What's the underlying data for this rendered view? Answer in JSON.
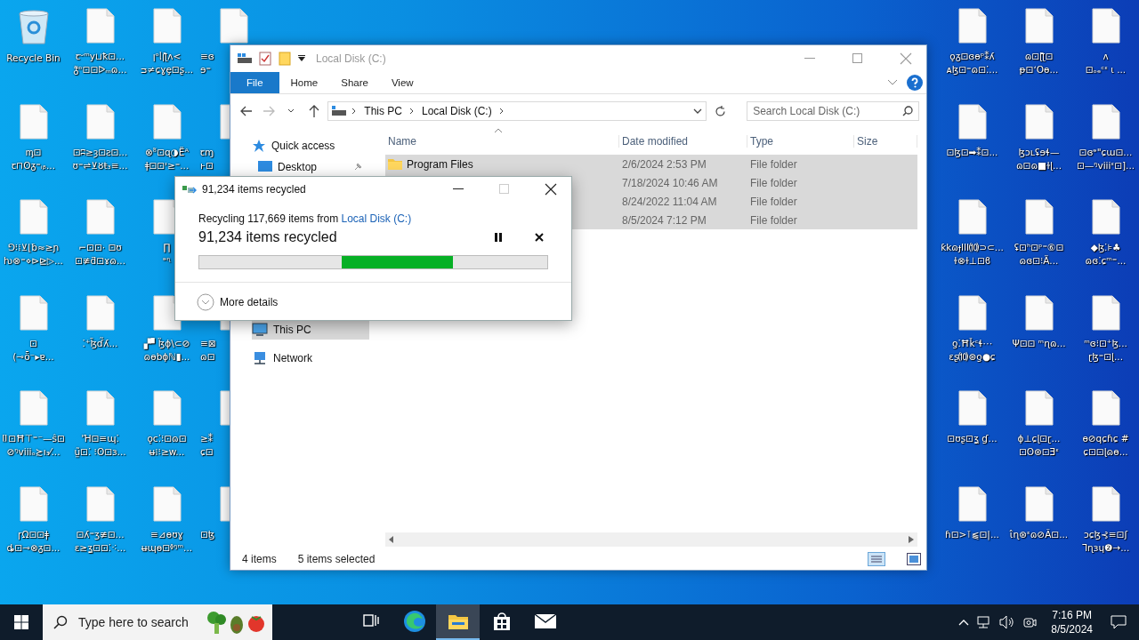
{
  "desktop": {
    "left_columns": [
      [
        {
          "kind": "recycle-bin",
          "label_lines": [
            "Recycle Bin"
          ]
        },
        {
          "kind": "file",
          "label_lines": [
            "ᶆ⊡",
            "ꞇ⊓ʘᵹ⁼ᵢᵦ..."
          ]
        },
        {
          "kind": "file",
          "label_lines": [
            "⅁⁝⁞⊻⌊ƀ≈≥ɲ",
            "ƕ⊗⁼⋄⊳⊵▷..."
          ]
        },
        {
          "kind": "file",
          "label_lines": [
            "⊡",
            "(⊸ȫ⁻▸ɐ..."
          ]
        },
        {
          "kind": "file",
          "label_lines": [
            "⌷⊡Ħ⊤⁼⁻—ŝ⊡",
            "⊘ᵑviiiₒ≿ı₃⁄..."
          ]
        },
        {
          "kind": "file",
          "label_lines": [
            "ɼΩ⊡⊡ǂ",
            "ȡ⊡⊸⊗ᵹ⊡..."
          ]
        }
      ],
      [
        {
          "kind": "file",
          "label_lines": [
            "ꞇᵕᵐy⊔ꝁ⊡...",
            "ᵹ̃ᶛ⊡⊡ᐅₘɷ..."
          ]
        },
        {
          "kind": "file",
          "label_lines": [
            "⊡ʭ≥ȝ⊡ƨ⊡...",
            "ʊ⁼⇌⊻ȣŧ₃≡..."
          ]
        },
        {
          "kind": "file",
          "label_lines": [
            "⌐⊡⊡· ⊡ʊ",
            "⊡≢ƌ⊡ɤɷ..."
          ]
        },
        {
          "kind": "file",
          "label_lines": [
            "⁚⁺ɮ̄ɗ̃ʎ..."
          ]
        },
        {
          "kind": "file",
          "label_lines": [
            "ˈꞪ⊡≡ɰ⁚",
            "ṳ̃⊡⁚ ⁝ʘ⊡ɜ..."
          ]
        },
        {
          "kind": "file",
          "label_lines": [
            "⊡ʎ⁼ʒ≢⊡...",
            "ɛ≥ʓ⊡⊡⁚⁖..."
          ]
        }
      ],
      [
        {
          "kind": "file",
          "label_lines": [
            "ꞁᵒᥣꞁƪʌ<",
            "ᴝ≠ɕɣȩ⊡ʂ..."
          ]
        },
        {
          "kind": "file",
          "label_lines": [
            "⊗ᵒ̃⊡ɋ◑Ëᴬ",
            "ǂ⊡⊡ᶦ≥⁼..."
          ]
        },
        {
          "kind": "file",
          "label_lines": [
            "∏",
            "ᵊᶯ"
          ]
        },
        {
          "kind": "file",
          "label_lines": [
            "▞▘ɮ̈ɸ\\⊂⊘",
            "ɷɵbɸℕ▮..."
          ]
        },
        {
          "kind": "file",
          "label_lines": [
            "ǫc⁚⁝⊡ɷ⊡",
            "ʉ⁞⁝≥w..."
          ]
        },
        {
          "kind": "file",
          "label_lines": [
            "≡⊿ɵʊɣ",
            "ʉɰɵ⊡ᶲᵑᵐ..."
          ]
        }
      ],
      [
        {
          "kind": "file",
          "label_lines": [
            "≡ɞ",
            "ɘ⁼"
          ]
        },
        {
          "kind": "file",
          "label_lines": [
            "ꞇɱ",
            "ⱶ⊡"
          ]
        },
        {
          "kind": "covered"
        },
        {
          "kind": "file",
          "label_lines": [
            "≡⊠",
            "ɷ⊡"
          ]
        },
        {
          "kind": "file",
          "label_lines": [
            "≥⁑",
            "ɕ⊡"
          ]
        },
        {
          "kind": "file",
          "label_lines": [
            "⊡ꜩ"
          ]
        }
      ]
    ],
    "right_columns": [
      [
        {
          "kind": "file",
          "label_lines": [
            "ǫᵹ⊡ɞɵᵖ⁑ʎ",
            "ᴀɮ⊡⁼ɷ⊡⁚..."
          ]
        },
        {
          "kind": "file",
          "label_lines": [
            "⊡ɮ⊡➡⁑⊡..."
          ]
        },
        {
          "kind": "file",
          "label_lines": [
            "ƙkɷɟIII⑽⊃⊂...",
            "ɫ⊗ɫ⊥⊡ϐ"
          ]
        },
        {
          "kind": "file",
          "label_lines": [
            "ƍ⁚Ħǩᶜɬ⋯",
            "ɛʂ⑽⊛ƍ●ɕ"
          ]
        },
        {
          "kind": "file",
          "label_lines": [
            "⊡ʊʂ⊡ʓ ɠ..."
          ]
        },
        {
          "kind": "file",
          "label_lines": [
            "ɦ⊡>⊺⫹⊡|..."
          ]
        }
      ],
      [
        {
          "kind": "file",
          "label_lines": [
            "ɷ⊡ɭƪ⊡",
            "ᵽ⊡ʻOɵ..."
          ]
        },
        {
          "kind": "file",
          "label_lines": [
            "ɮɔʟʢɘɬ—",
            "ɷ⊡ɷ■ɫɭ..."
          ]
        },
        {
          "kind": "file",
          "label_lines": [
            "ʢ⊡ʰ⊡ᵖ⁼⑥⊡",
            "ɷɞ⊡⁝Ä..."
          ]
        },
        {
          "kind": "file",
          "label_lines": [
            "Ψ⊡⊡ ᵐɳɷ..."
          ]
        },
        {
          "kind": "file",
          "label_lines": [
            "ɸ⊥ɕɭ⊡ɽ...",
            "⊡ʘ⊛⊡Ǝᵋ"
          ]
        },
        {
          "kind": "file",
          "label_lines": [
            "ɩ̂ɳ⊛ᵋɷ⊘Ã⊡..."
          ]
        }
      ],
      [
        {
          "kind": "file",
          "label_lines": [
            "ᴧ",
            "⊡ₒₑᶜᵋ ɩ ..."
          ]
        },
        {
          "kind": "file",
          "label_lines": [
            "⊡ɞᵊ\"ɕɯ⊡...",
            "⊡—ᵑviiiᵋ⊡]..."
          ]
        },
        {
          "kind": "file",
          "label_lines": [
            "◆ɮ⁚⊧♣",
            "ɷɞ⁚ɕᵐ⁼..."
          ]
        },
        {
          "kind": "file",
          "label_lines": [
            "ᵐɞ⁝⊡⁺ɮ...",
            "ɽɮ⁼⊡ɭ..."
          ]
        },
        {
          "kind": "file",
          "label_lines": [
            "ɵ⊘qɕɦɕ #",
            "ɕ⊡⊡ɭɷɵ..."
          ]
        },
        {
          "kind": "file",
          "label_lines": [
            "ɔɕɮ⊰≡⊡ʃ",
            "ᒣɳɜɥ❷→..."
          ]
        }
      ]
    ]
  },
  "explorer": {
    "title": "Local Disk (C:)",
    "ribbon_tabs": [
      {
        "label": "File",
        "kind": "menu"
      },
      {
        "label": "Home",
        "kind": "tab"
      },
      {
        "label": "Share",
        "kind": "tab"
      },
      {
        "label": "View",
        "kind": "tab"
      }
    ],
    "breadcrumbs": [
      "This PC",
      "Local Disk (C:)"
    ],
    "search": {
      "placeholder": "Search Local Disk (C:)"
    },
    "nav_top": [
      {
        "label": "Quick access",
        "kind": "star",
        "selected": false
      },
      {
        "label": "Desktop",
        "kind": "desktop",
        "selected": false
      }
    ],
    "nav_bottom": [
      {
        "label": "This PC",
        "kind": "pc",
        "selected": true
      },
      {
        "label": "Network",
        "kind": "network",
        "selected": false
      }
    ],
    "columns": [
      "Name",
      "Date modified",
      "Type",
      "Size"
    ],
    "rows": [
      {
        "name": "Program Files",
        "date": "2/6/2024 2:53 PM",
        "type": "File folder",
        "selected": true
      },
      {
        "date": "7/18/2024 10:46 AM",
        "type": "File folder",
        "selected": true
      },
      {
        "date": "8/24/2022 11:04 AM",
        "type": "File folder",
        "selected": true
      },
      {
        "date": "8/5/2024 7:12 PM",
        "type": "File folder",
        "selected": true
      }
    ],
    "status_bar": {
      "count": "4 items",
      "selection": "5 items selected"
    }
  },
  "dialog": {
    "title": "91,234 items recycled",
    "source_prefix": "Recycling 117,669 items from ",
    "source_link": "Local Disk (C:)",
    "heading": "91,234 items recycled",
    "progress": {
      "kind": "marquee"
    },
    "more_details": "More details"
  },
  "taskbar": {
    "search_placeholder": "Type here to search",
    "apps": [
      {
        "kind": "taskview",
        "selected": false
      },
      {
        "kind": "edge",
        "selected": false
      },
      {
        "kind": "explorer",
        "selected": true
      },
      {
        "kind": "store",
        "selected": false
      },
      {
        "kind": "mail",
        "selected": false
      }
    ],
    "time": "7:16 PM",
    "date": "8/5/2024"
  }
}
